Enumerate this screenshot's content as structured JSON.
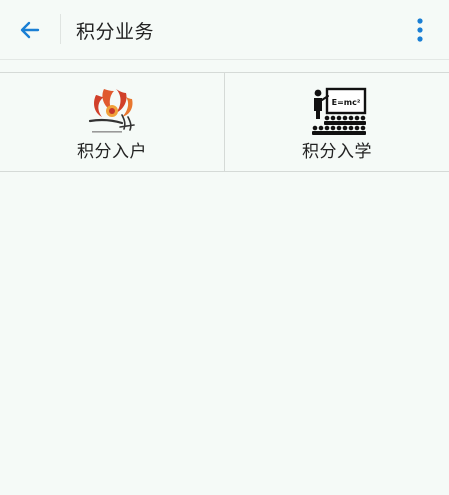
{
  "header": {
    "title": "积分业务",
    "back_icon": "arrow-left-icon",
    "menu_icon": "more-vertical-icon",
    "accent": "#1a7fd4"
  },
  "tiles": [
    {
      "label": "积分入户",
      "icon": "household-logo-icon"
    },
    {
      "label": "积分入学",
      "icon": "classroom-teacher-icon",
      "icon_text": "E=mc²"
    }
  ]
}
